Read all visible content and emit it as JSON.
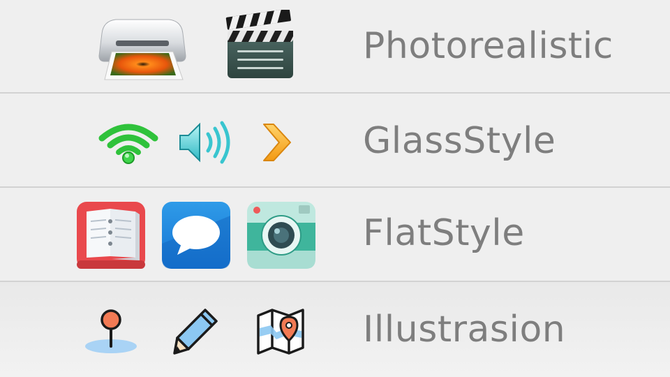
{
  "rows": [
    {
      "label": "Photorealistic",
      "icons": [
        "printer-icon",
        "clapperboard-icon"
      ]
    },
    {
      "label": "GlassStyle",
      "icons": [
        "wifi-icon",
        "speaker-icon",
        "chevron-right-icon"
      ]
    },
    {
      "label": "FlatStyle",
      "icons": [
        "notebook-icon",
        "chat-bubble-icon",
        "camera-icon"
      ]
    },
    {
      "label": "Illustrasion",
      "icons": [
        "map-pin-icon",
        "pencil-icon",
        "folded-map-icon"
      ]
    }
  ]
}
